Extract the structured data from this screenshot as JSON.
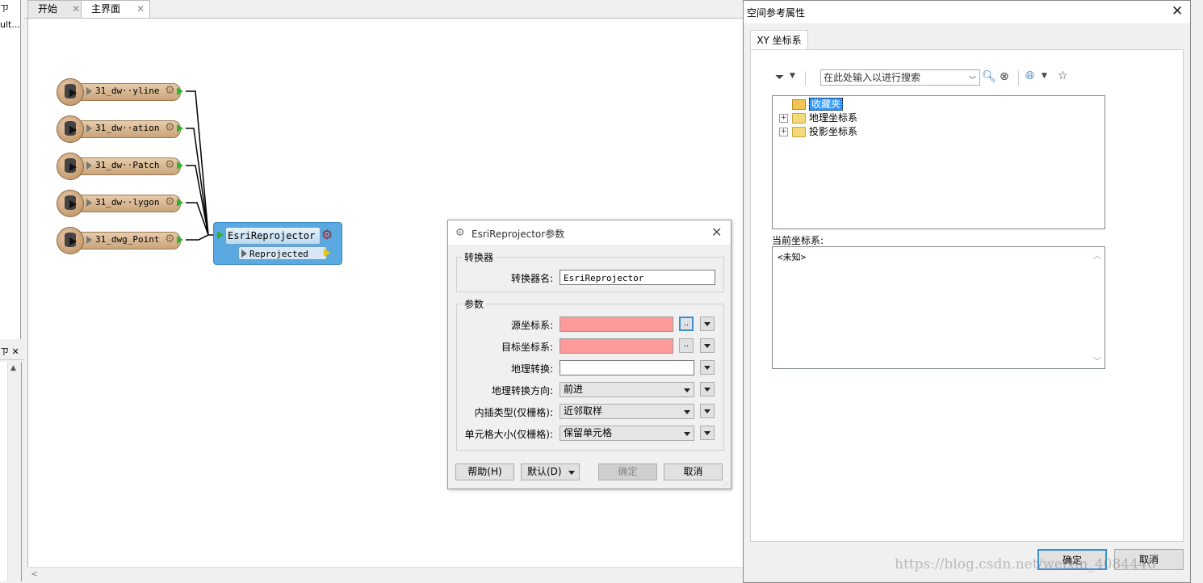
{
  "left_panel": {
    "top_label1": "ㄗ",
    "top_label2": "ult...",
    "mid_label": "ㄗ ✕"
  },
  "tabs": [
    {
      "label": "开始"
    },
    {
      "label": "主界面"
    }
  ],
  "readers": [
    {
      "label": "31_dw··yline"
    },
    {
      "label": "31_dw··ation"
    },
    {
      "label": "31_dw··Patch"
    },
    {
      "label": "31_dw··lygon"
    },
    {
      "label": "31_dwg_Point"
    }
  ],
  "transformer": {
    "name": "EsriReprojector",
    "output_port": "Reprojected"
  },
  "param_dialog": {
    "title": "EsriReprojector参数",
    "group_transformer": "转换器",
    "transformer_name_label": "转换器名:",
    "transformer_name_value": "EsriReprojector",
    "group_params": "参数",
    "source_cs_label": "源坐标系:",
    "target_cs_label": "目标坐标系:",
    "geo_transform_label": "地理转换:",
    "geo_direction_label": "地理转换方向:",
    "geo_direction_value": "前进",
    "interp_label": "内插类型(仅栅格):",
    "interp_value": "近邻取样",
    "cell_size_label": "单元格大小(仅栅格):",
    "cell_size_value": "保留单元格",
    "browse_label": "..",
    "help_button": "帮助(H)",
    "default_button": "默认(D)",
    "ok_button": "确定",
    "cancel_button": "取消"
  },
  "sr_dialog": {
    "title": "空间参考属性",
    "tab": "XY 坐标系",
    "search_placeholder": "在此处输入以进行搜索",
    "tree": [
      {
        "label": "收藏夹",
        "selected": true
      },
      {
        "label": "地理坐标系"
      },
      {
        "label": "投影坐标系"
      }
    ],
    "current_label": "当前坐标系:",
    "current_value": "<未知>",
    "ok_button": "确定",
    "cancel_button": "取消"
  },
  "watermark": "https://blog.csdn.net/weixin_4084446"
}
